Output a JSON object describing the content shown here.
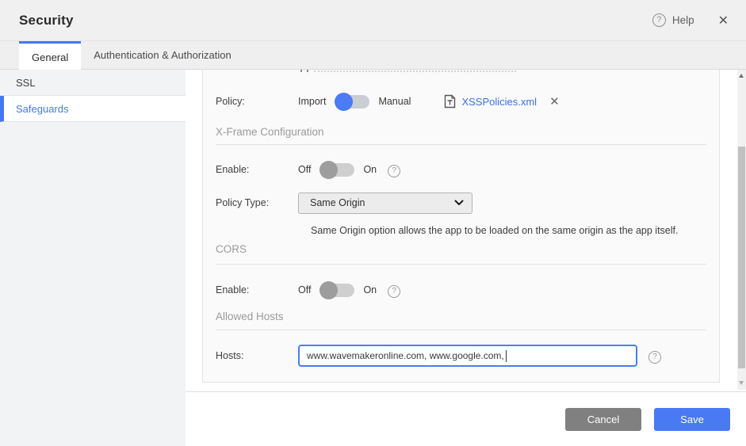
{
  "header": {
    "title": "Security",
    "help_label": "Help"
  },
  "icons": {
    "help_glyph": "?",
    "close_glyph": "✕",
    "remove_glyph": "✕"
  },
  "tabs": [
    {
      "label": "General",
      "active": true
    },
    {
      "label": "Authentication & Authorization",
      "active": false
    }
  ],
  "sidebar": {
    "items": [
      {
        "label": "SSL",
        "selected": false
      },
      {
        "label": "Safeguards",
        "selected": true
      }
    ]
  },
  "panel": {
    "policy": {
      "label": "Policy:",
      "option_left": "Import",
      "option_right": "Manual",
      "toggle_state": "Import",
      "file_name": "XSSPolicies.xml"
    },
    "xframe": {
      "heading": "X-Frame Configuration",
      "enable_label": "Enable:",
      "off_label": "Off",
      "on_label": "On",
      "enable_state": "Off",
      "policy_type_label": "Policy Type:",
      "policy_type_value": "Same Origin",
      "description": "Same Origin option allows the app to be loaded on the same origin as the app itself."
    },
    "cors": {
      "heading": "CORS",
      "enable_label": "Enable:",
      "off_label": "Off",
      "on_label": "On",
      "enable_state": "Off"
    },
    "allowed_hosts": {
      "heading": "Allowed Hosts",
      "hosts_label": "Hosts:",
      "hosts_value": "www.wavemakeronline.com, www.google.com,"
    }
  },
  "footer": {
    "cancel_label": "Cancel",
    "save_label": "Save"
  },
  "colors": {
    "accent": "#4678f2",
    "link": "#3c6fe3",
    "save_button": "#4a79f4",
    "cancel_button": "#808080",
    "heading_gray": "#9b9b9b",
    "sidebar_bg": "#f2f3f5",
    "panel_bg": "#fafafa"
  }
}
